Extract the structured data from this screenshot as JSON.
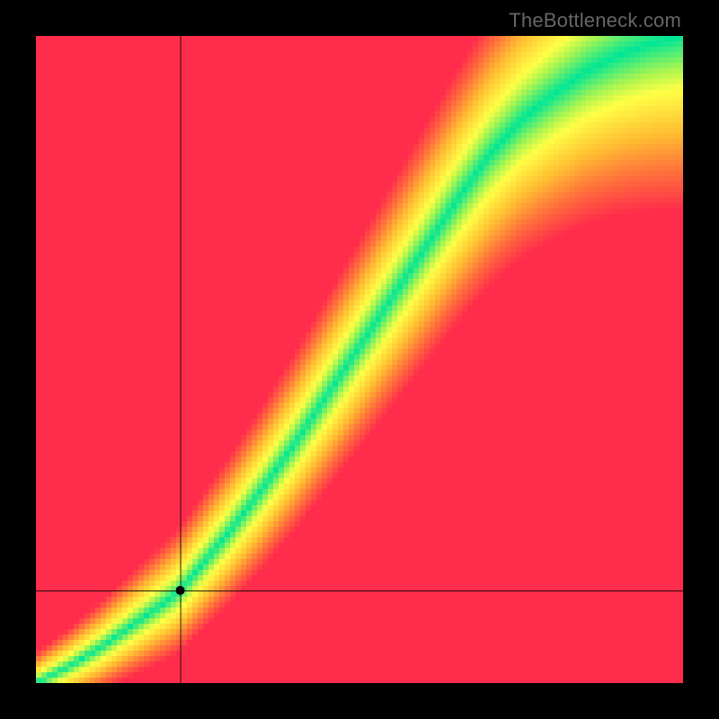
{
  "watermark": "TheBottleneck.com",
  "chart_data": {
    "type": "heatmap",
    "title": "",
    "xlabel": "",
    "ylabel": "",
    "xlim": [
      0,
      1
    ],
    "ylim": [
      0,
      1
    ],
    "resolution": 120,
    "marker": {
      "x": 0.223,
      "y": 0.143
    },
    "crosshair": {
      "x": 0.223,
      "y": 0.143
    },
    "optimal_curve": {
      "description": "Piecewise curve mapping x to optimal y; green ridge runs along this curve",
      "points": [
        [
          0.0,
          0.0
        ],
        [
          0.05,
          0.025
        ],
        [
          0.1,
          0.055
        ],
        [
          0.15,
          0.09
        ],
        [
          0.2,
          0.125
        ],
        [
          0.223,
          0.143
        ],
        [
          0.25,
          0.175
        ],
        [
          0.3,
          0.235
        ],
        [
          0.35,
          0.3
        ],
        [
          0.4,
          0.37
        ],
        [
          0.45,
          0.445
        ],
        [
          0.5,
          0.52
        ],
        [
          0.55,
          0.595
        ],
        [
          0.6,
          0.67
        ],
        [
          0.65,
          0.745
        ],
        [
          0.7,
          0.815
        ],
        [
          0.75,
          0.87
        ],
        [
          0.8,
          0.91
        ],
        [
          0.85,
          0.945
        ],
        [
          0.9,
          0.97
        ],
        [
          0.95,
          0.988
        ],
        [
          1.0,
          1.0
        ]
      ]
    },
    "band_width_base": 0.015,
    "band_width_growth": 0.075,
    "colormap": {
      "stops": [
        {
          "t": 0.0,
          "rgb": [
            0,
            230,
            150
          ]
        },
        {
          "t": 0.18,
          "rgb": [
            170,
            245,
            80
          ]
        },
        {
          "t": 0.3,
          "rgb": [
            255,
            255,
            70
          ]
        },
        {
          "t": 0.55,
          "rgb": [
            255,
            190,
            50
          ]
        },
        {
          "t": 0.78,
          "rgb": [
            255,
            110,
            60
          ]
        },
        {
          "t": 1.0,
          "rgb": [
            255,
            45,
            75
          ]
        }
      ]
    }
  }
}
